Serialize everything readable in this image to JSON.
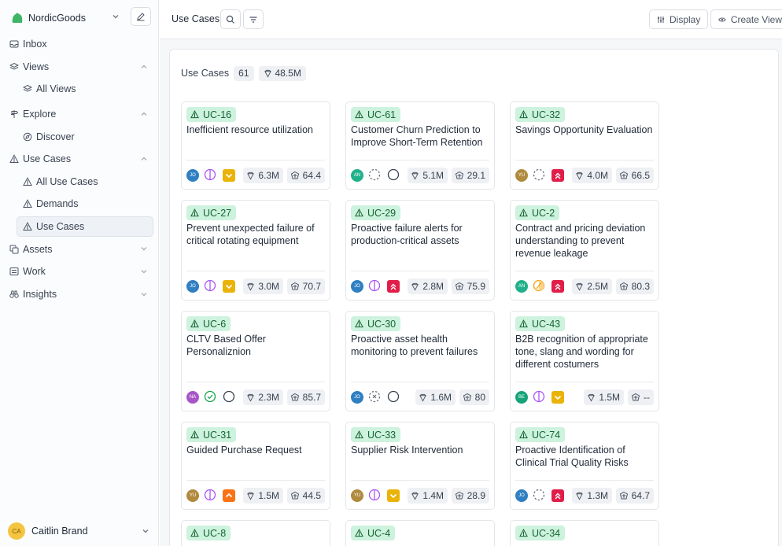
{
  "workspace": {
    "name": "NordicGoods"
  },
  "nav": {
    "inbox": "Inbox",
    "views": "Views",
    "all_views": "All Views",
    "explore": "Explore",
    "discover": "Discover",
    "use_cases": "Use Cases",
    "all_use_cases": "All Use Cases",
    "demands": "Demands",
    "use_cases_sub": "Use Cases",
    "assets": "Assets",
    "work": "Work",
    "insights": "Insights"
  },
  "user": {
    "name": "Caitlin Brand",
    "initials": "CA"
  },
  "topbar": {
    "title": "Use Cases",
    "display": "Display",
    "create_view": "Create View"
  },
  "summary": {
    "label": "Use Cases",
    "count": "61",
    "value": "48.5M"
  },
  "colors": {
    "accent_green": "#cdf2dd",
    "priority_orange": "#eab308",
    "priority_red": "#e11d48"
  },
  "cards": [
    {
      "id": "UC-16",
      "title": "Inefficient resource utilization",
      "assignee": "JO",
      "assignee_color": "#2f7fc1",
      "status": "in-review",
      "priority": "medium",
      "value": "6.3M",
      "score": "64.4"
    },
    {
      "id": "UC-61",
      "title": "Customer Churn Prediction to Improve Short-Term Retention",
      "assignee": "AN",
      "assignee_color": "#20b08a",
      "status": "backlog",
      "priority": "none",
      "value": "5.1M",
      "score": "29.1"
    },
    {
      "id": "UC-32",
      "title": "Savings Opportunity Evaluation",
      "assignee": "YU",
      "assignee_color": "#b08a3e",
      "status": "backlog",
      "priority": "urgent",
      "value": "4.0M",
      "score": "66.5"
    },
    {
      "id": "UC-27",
      "title": "Prevent unexpected failure of critical rotating equipment",
      "assignee": "JO",
      "assignee_color": "#2f7fc1",
      "status": "in-review",
      "priority": "medium",
      "value": "3.0M",
      "score": "70.7"
    },
    {
      "id": "UC-29",
      "title": "Proactive failure alerts for production-critical assets",
      "assignee": "JO",
      "assignee_color": "#2f7fc1",
      "status": "in-review",
      "priority": "urgent",
      "value": "2.8M",
      "score": "75.9"
    },
    {
      "id": "UC-2",
      "title": "Contract and pricing deviation understanding to prevent revenue leakage",
      "assignee": "AN",
      "assignee_color": "#20b08a",
      "status": "in-progress",
      "priority": "urgent",
      "value": "2.5M",
      "score": "80.3"
    },
    {
      "id": "UC-6",
      "title": "CLTV Based Offer Personaliznion",
      "assignee": "NA",
      "assignee_color": "#a855c7",
      "status": "done",
      "priority": "none",
      "value": "2.3M",
      "score": "85.7"
    },
    {
      "id": "UC-30",
      "title": "Proactive asset health monitoring to prevent failures",
      "assignee": "JO",
      "assignee_color": "#2f7fc1",
      "status": "canceled",
      "priority": "none",
      "value": "1.6M",
      "score": "80"
    },
    {
      "id": "UC-43",
      "title": "B2B recognition of appropriate tone, slang and wording for different costumers",
      "assignee": "BE",
      "assignee_color": "#16a37a",
      "status": "in-review",
      "priority": "medium",
      "value": "1.5M",
      "score": "--"
    },
    {
      "id": "UC-31",
      "title": "Guided Purchase Request",
      "assignee": "YU",
      "assignee_color": "#b08a3e",
      "status": "in-review",
      "priority": "high",
      "value": "1.5M",
      "score": "44.5"
    },
    {
      "id": "UC-33",
      "title": "Supplier Risk Intervention",
      "assignee": "YU",
      "assignee_color": "#b08a3e",
      "status": "in-review",
      "priority": "medium",
      "value": "1.4M",
      "score": "28.9"
    },
    {
      "id": "UC-74",
      "title": "Proactive Identification of Clinical Trial Quality Risks",
      "assignee": "JO",
      "assignee_color": "#2f7fc1",
      "status": "backlog",
      "priority": "urgent",
      "value": "1.3M",
      "score": "64.7"
    },
    {
      "id": "UC-8",
      "title": "",
      "assignee": "",
      "assignee_color": "#2f7fc1",
      "status": "",
      "priority": "",
      "value": "",
      "score": ""
    },
    {
      "id": "UC-4",
      "title": "",
      "assignee": "",
      "assignee_color": "#2f7fc1",
      "status": "",
      "priority": "",
      "value": "",
      "score": ""
    },
    {
      "id": "UC-34",
      "title": "",
      "assignee": "",
      "assignee_color": "#2f7fc1",
      "status": "",
      "priority": "",
      "value": "",
      "score": ""
    }
  ]
}
